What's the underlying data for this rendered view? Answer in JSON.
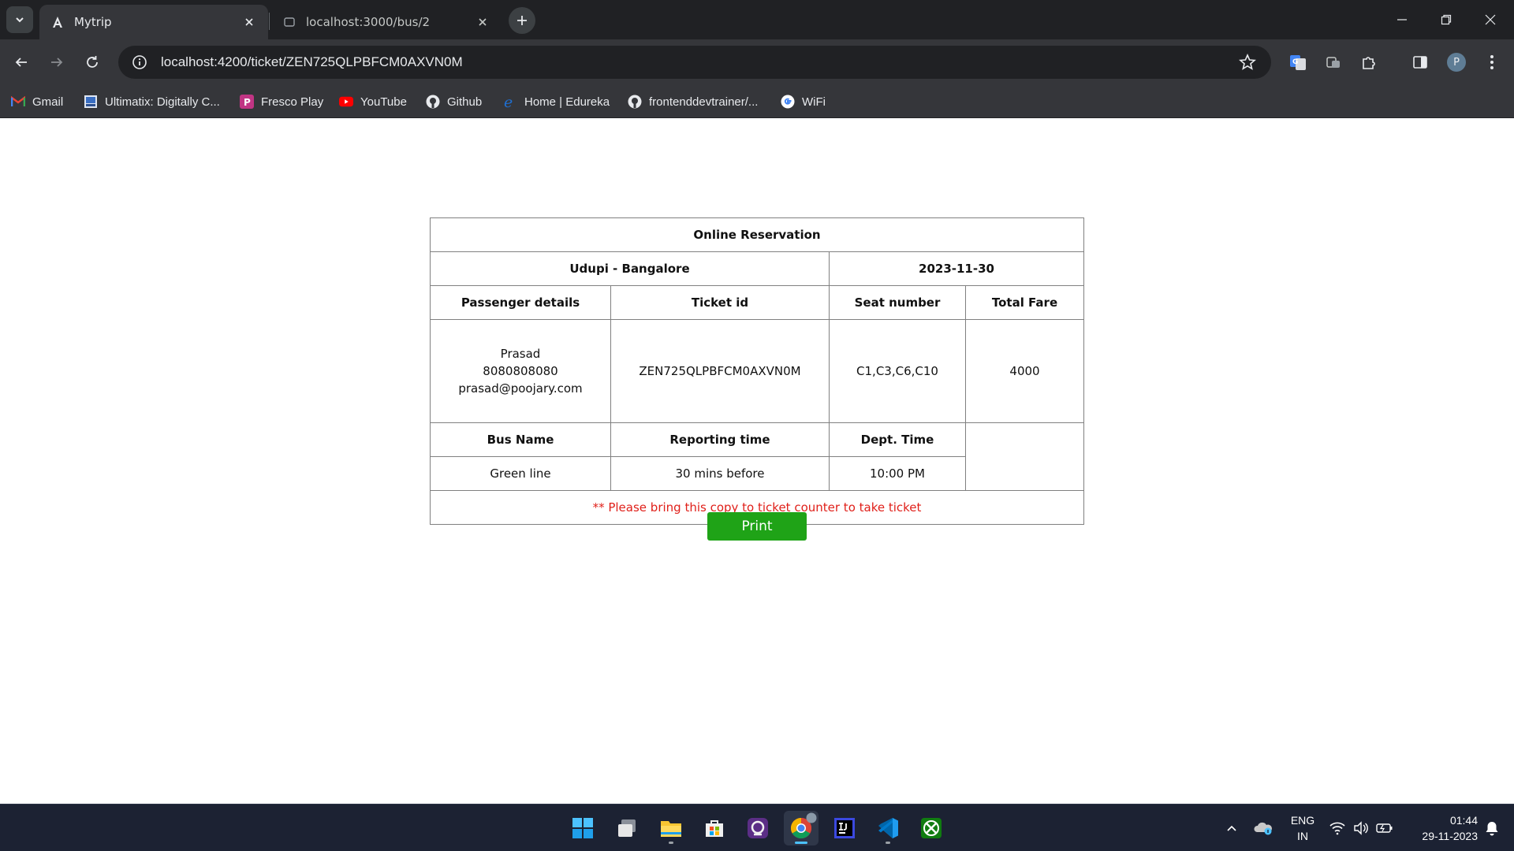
{
  "browser": {
    "tabs": [
      {
        "title": "Mytrip",
        "icon": "angular-icon",
        "active": true
      },
      {
        "title": "localhost:3000/bus/2",
        "icon": "page-icon",
        "active": false
      }
    ],
    "url": "localhost:4200/ticket/ZEN725QLPBFCM0AXVN0M",
    "profile_initial": "P",
    "bookmarks": [
      {
        "label": "Gmail",
        "icon": "gmail-icon"
      },
      {
        "label": "Ultimatix: Digitally C...",
        "icon": "ultimatix-icon"
      },
      {
        "label": "Fresco Play",
        "icon": "fresco-icon"
      },
      {
        "label": "YouTube",
        "icon": "youtube-icon"
      },
      {
        "label": "Github",
        "icon": "github-icon"
      },
      {
        "label": "Home | Edureka",
        "icon": "edureka-icon"
      },
      {
        "label": "frontenddevtrainer/...",
        "icon": "github-icon"
      },
      {
        "label": "WiFi",
        "icon": "google-icon"
      }
    ]
  },
  "ticket": {
    "heading": "Online Reservation",
    "route": "Udupi - Bangalore",
    "date": "2023-11-30",
    "headers": {
      "passenger": "Passenger details",
      "ticket_id": "Ticket id",
      "seat": "Seat number",
      "fare": "Total Fare",
      "bus_name": "Bus Name",
      "reporting": "Reporting time",
      "dept": "Dept. Time"
    },
    "passenger": {
      "name": "Prasad",
      "phone": "8080808080",
      "email": "prasad@poojary.com"
    },
    "ticket_id": "ZEN725QLPBFCM0AXVN0M",
    "seats": "C1,C3,C6,C10",
    "fare": "4000",
    "bus_name": "Green line",
    "reporting_time": "30 mins before",
    "dept_time": "10:00 PM",
    "note": "** Please bring this copy to ticket counter to take ticket"
  },
  "print_label": "Print",
  "colors": {
    "note": "#e0201a",
    "print_button": "#1fa317"
  },
  "taskbar": {
    "language": "ENG",
    "region": "IN",
    "time": "01:44",
    "date": "29-11-2023"
  }
}
